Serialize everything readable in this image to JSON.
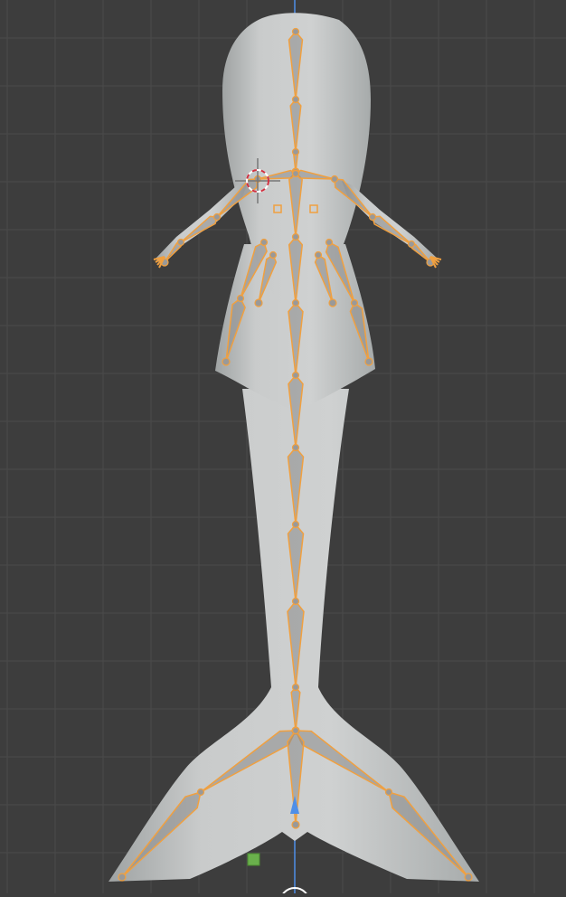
{
  "viewport": {
    "background_color": "#3d3d3d",
    "grid_color": "#4a4a4a",
    "z_axis_color": "#4f8fe8",
    "mesh_color": "#c4c6c6",
    "bone_selected_color": "#f0a040",
    "bone_fill_color": "#8a8a8a",
    "cursor_color": "#d03040",
    "empty_color": "#6ab04c"
  }
}
